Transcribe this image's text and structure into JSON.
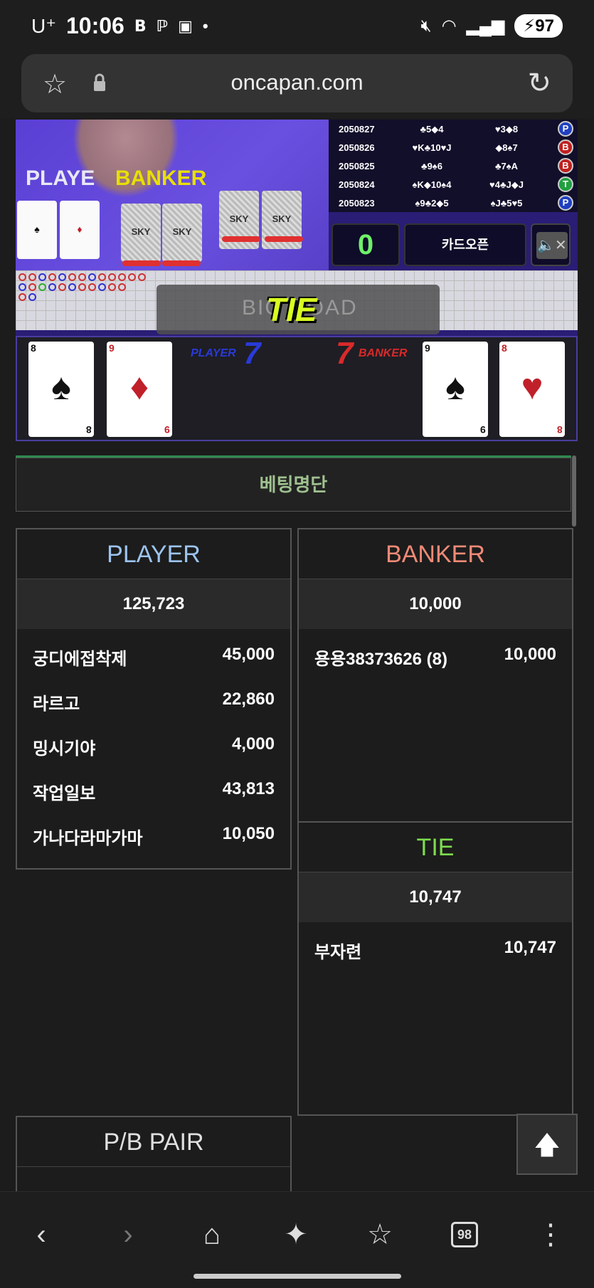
{
  "status": {
    "carrier": "U⁺",
    "time": "10:06",
    "battery": "97"
  },
  "browser": {
    "url": "oncapan.com"
  },
  "game": {
    "video": {
      "player_label": "PLAYE",
      "banker_label": "BANKER",
      "sky": "SKY"
    },
    "history": [
      {
        "id": "2050827",
        "player": "♣5◆4",
        "banker": "♥3◆8",
        "result": "P"
      },
      {
        "id": "2050826",
        "player": "♥K♣10♥J",
        "banker": "◆8♠7",
        "result": "B"
      },
      {
        "id": "2050825",
        "player": "♣9♠6",
        "banker": "♣7♠A",
        "result": "B"
      },
      {
        "id": "2050824",
        "player": "♠K◆10♠4",
        "banker": "♥4♣J◆J",
        "result": "T"
      },
      {
        "id": "2050823",
        "player": "♠9♣2◆5",
        "banker": "♠J♣5♥5",
        "result": "P"
      }
    ],
    "counter": "0",
    "card_open": "카드오픈",
    "tie_banner": "TIE",
    "bigroad_ghost": "BIG ROAD",
    "result": {
      "player_label": "PLAYER",
      "player_score": "7",
      "banker_label": "BANKER",
      "banker_score": "7",
      "player_cards": [
        {
          "rank": "8",
          "suit": "♠",
          "color": "black"
        },
        {
          "rank": "9",
          "suit": "♦",
          "color": "red"
        }
      ],
      "banker_cards": [
        {
          "rank": "9",
          "suit": "♠",
          "color": "black"
        },
        {
          "rank": "8",
          "suit": "♥",
          "color": "red"
        }
      ]
    }
  },
  "betting": {
    "title": "베팅명단",
    "player": {
      "header": "PLAYER",
      "total": "125,723",
      "color": "#9cc4f0",
      "rows": [
        {
          "name": "궁디에접착제",
          "amount": "45,000"
        },
        {
          "name": "라르고",
          "amount": "22,860"
        },
        {
          "name": "밍시기야",
          "amount": "4,000"
        },
        {
          "name": "작업일보",
          "amount": "43,813"
        },
        {
          "name": "가나다라마가마",
          "amount": "10,050"
        }
      ]
    },
    "banker": {
      "header": "BANKER",
      "total": "10,000",
      "color": "#f08a76",
      "rows": [
        {
          "name": "용용38373626 (8)",
          "amount": "10,000"
        }
      ]
    },
    "tie": {
      "header": "TIE",
      "total": "10,747",
      "color": "#7ddc4e",
      "rows": [
        {
          "name": "부자련",
          "amount": "10,747"
        }
      ]
    },
    "pair": {
      "header": "P/B PAIR"
    }
  },
  "nav": {
    "tab_count": "98"
  }
}
